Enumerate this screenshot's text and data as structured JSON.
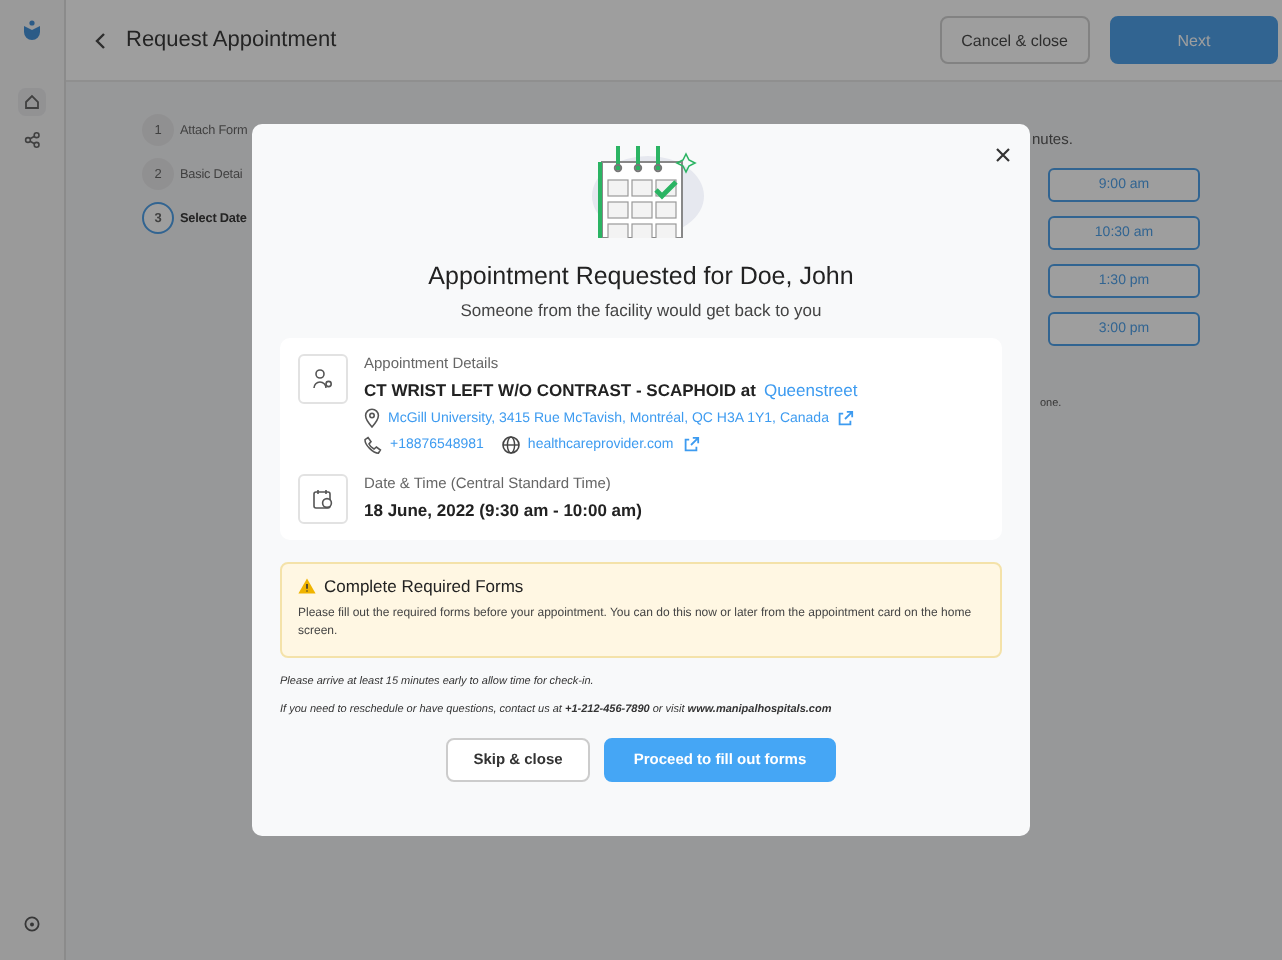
{
  "header": {
    "title": "Request Appointment",
    "buttons": [
      {
        "label": "Cancel & close",
        "kind": "secondary"
      },
      {
        "label": "Next",
        "kind": "primary"
      }
    ]
  },
  "steps": [
    {
      "number": "1",
      "label": "Attach Form",
      "selected": false
    },
    {
      "number": "2",
      "label": "Basic Detai",
      "selected": false
    },
    {
      "number": "3",
      "label": "Select Date",
      "selected": true
    }
  ],
  "time_panel": {
    "note": "nutes.",
    "slots": [
      "9:00 am",
      "10:30 am",
      "1:30 pm",
      "3:00 pm"
    ],
    "footnote": "one."
  },
  "modal": {
    "title": "Appointment Requested for Doe, John",
    "subtitle": "Someone from the facility would get back to you",
    "details": {
      "heading": "Appointment Details",
      "procedure": "CT WRIST LEFT W/O CONTRAST - SCAPHOID at",
      "facility": "Queenstreet",
      "address": "McGill University, 3415 Rue McTavish, Montréal, QC H3A 1Y1, Canada",
      "phone": "+18876548981",
      "website": "healthcareprovider.com"
    },
    "datetime": {
      "heading": "Date & Time (Central Standard Time)",
      "value": "18 June, 2022 (9:30 am - 10:00 am)"
    },
    "alert": {
      "title": "Complete Required Forms",
      "body": "Please fill out the required forms before your appointment. You can do this now or later from the appointment card on the home screen."
    },
    "notes": [
      "Please arrive at least 15 minutes early to allow time for check-in.",
      "If you need to reschedule or have questions, contact us at **+1-212-456-7890**  or visit **www.manipalhospitals.com**"
    ],
    "buttons": [
      {
        "label": "Skip & close",
        "kind": "secondary"
      },
      {
        "label": "Proceed to fill out forms",
        "kind": "primary"
      }
    ]
  }
}
